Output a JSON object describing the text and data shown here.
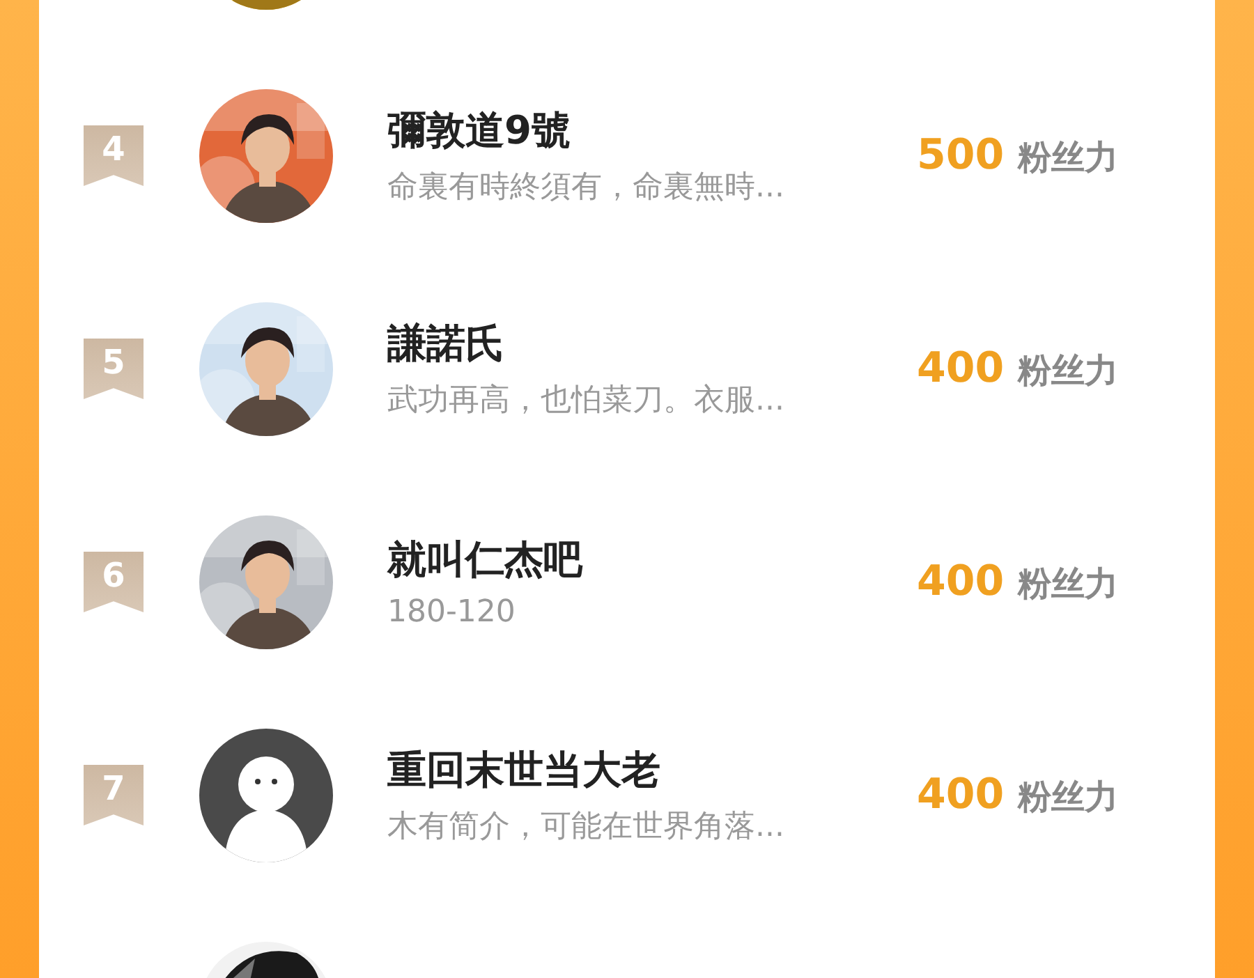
{
  "rows": [
    {
      "rank": "4",
      "name": "彌敦道9號",
      "bio": "命裏有時終須有，命裏無時...",
      "score": "500",
      "unit": "粉丝力"
    },
    {
      "rank": "5",
      "name": "謙諾氏",
      "bio": "武功再高，也怕菜刀。衣服...",
      "score": "400",
      "unit": "粉丝力"
    },
    {
      "rank": "6",
      "name": "就叫仁杰吧",
      "bio": "180-120",
      "score": "400",
      "unit": "粉丝力"
    },
    {
      "rank": "7",
      "name": "重回末世当大老",
      "bio": "木有简介，可能在世界角落...",
      "score": "400",
      "unit": "粉丝力",
      "avatar": {
        "kind": "default"
      }
    }
  ]
}
